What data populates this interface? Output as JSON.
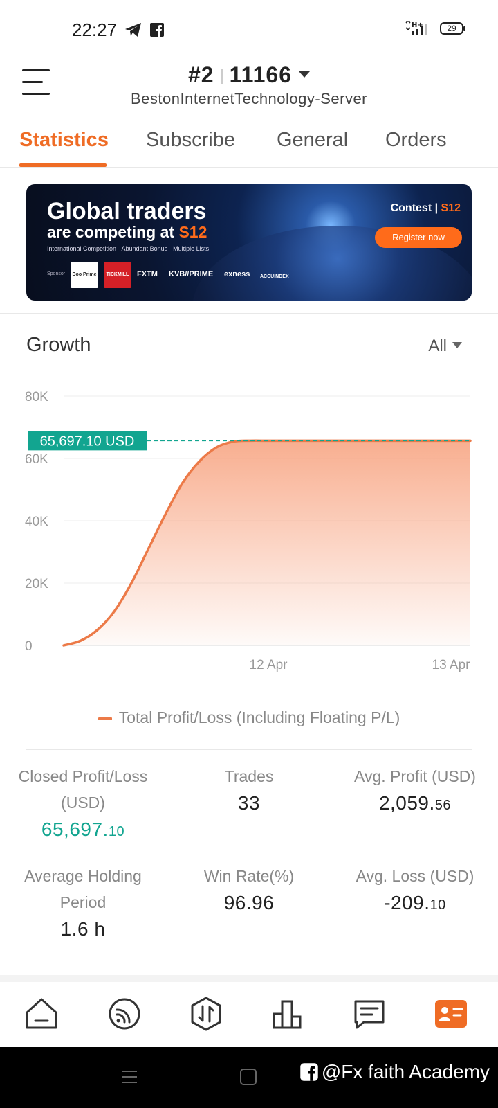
{
  "status_bar": {
    "time": "22:27",
    "network": "H+",
    "battery": "29"
  },
  "header": {
    "account_number": "#2",
    "account_id": "11166",
    "server": "BestonInternetTechnology-Server"
  },
  "tabs": [
    {
      "label": "Statistics",
      "active": true
    },
    {
      "label": "Subscribe",
      "active": false
    },
    {
      "label": "General",
      "active": false
    },
    {
      "label": "Orders",
      "active": false
    }
  ],
  "banner": {
    "title_line1": "Global traders",
    "title_line2_prefix": "are competing at ",
    "title_line2_brand": "S12",
    "subtitle": "International Competition · Abundant Bonus · Multiple Lists",
    "sponsor_label": "Sponsor",
    "sponsors": [
      "Doo Prime",
      "TICKMILL",
      "FXTM",
      "KVB//PRIME",
      "exness",
      "ACCUINDEX"
    ],
    "contest_label": "Contest",
    "contest_brand": "S12",
    "cta": "Register now"
  },
  "growth": {
    "title": "Growth",
    "range": "All"
  },
  "chart_data": {
    "type": "area",
    "y_ticks": [
      "80K",
      "60K",
      "40K",
      "20K",
      "0"
    ],
    "x_ticks": [
      "12 Apr",
      "13 Apr"
    ],
    "ylim": [
      0,
      80000
    ],
    "series": [
      {
        "name": "Total Profit/Loss (Including Floating P/L)",
        "values": [
          0,
          1500,
          5000,
          11000,
          20000,
          31000,
          42000,
          52000,
          59000,
          63500,
          65400,
          65697.1,
          65697.1,
          65697.1,
          65697.1,
          65697.1,
          65697.1,
          65697.1,
          65697.1,
          65697.1,
          65697.1,
          65697.1,
          65697.1,
          65697.1,
          65697.1
        ]
      }
    ],
    "current_value_label": "65,697.10 USD",
    "current_value": 65697.1,
    "colors": {
      "line": "#ec7a48",
      "fill": "#f7a07c",
      "marker": "#12a590"
    }
  },
  "stats": {
    "closed_pl": {
      "label_line1": "Closed Profit/Loss",
      "label_line2": "(USD)",
      "value_int": "65,697.",
      "value_dec": "10"
    },
    "trades": {
      "label": "Trades",
      "value": "33"
    },
    "avg_profit": {
      "label": "Avg. Profit (USD)",
      "value_int": "2,059.",
      "value_dec": "56"
    },
    "avg_holding": {
      "label_line1": "Average Holding",
      "label_line2": "Period",
      "value": "1.6 h"
    },
    "win_rate": {
      "label": "Win Rate(%)",
      "value": "96.96"
    },
    "avg_loss": {
      "label": "Avg. Loss (USD)",
      "value_int": "-209.",
      "value_dec": "10"
    }
  },
  "bottom_nav": [
    {
      "icon": "home-icon",
      "active": false
    },
    {
      "icon": "signal-icon",
      "active": false
    },
    {
      "icon": "trade-icon",
      "active": false
    },
    {
      "icon": "chart-bars-icon",
      "active": false
    },
    {
      "icon": "message-icon",
      "active": false
    },
    {
      "icon": "profile-card-icon",
      "active": true
    }
  ],
  "colors": {
    "accent": "#ef6c25",
    "positive": "#12a590"
  },
  "watermark": "@Fx faith Academy"
}
